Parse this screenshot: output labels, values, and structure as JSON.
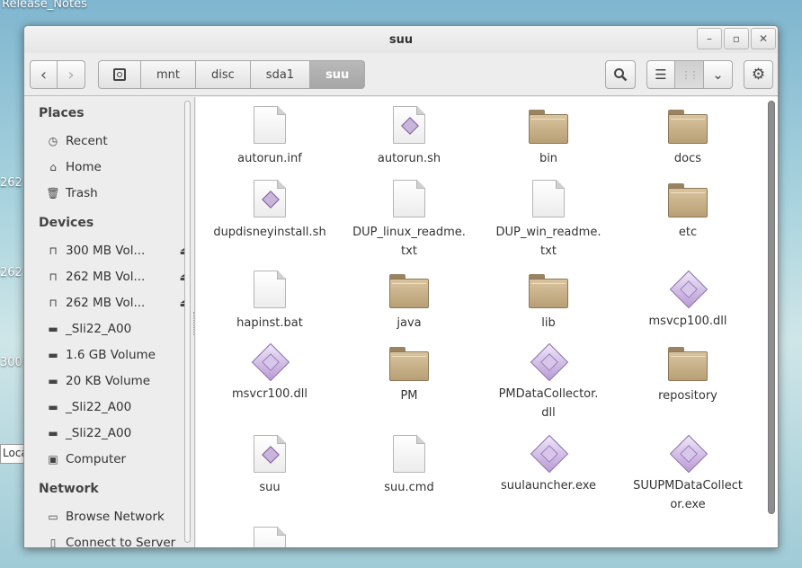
{
  "desktop": {
    "top_label": "Release_Notes",
    "side_numbers": [
      "262",
      "262",
      "300"
    ],
    "side_label": "Loca"
  },
  "window": {
    "title": "suu",
    "wm": {
      "minimize": "–",
      "maximize": "▫",
      "close": "✕"
    }
  },
  "toolbar": {
    "back_glyph": "‹",
    "forward_glyph": "›",
    "breadcrumbs": [
      "mnt",
      "disc",
      "sda1",
      "suu"
    ],
    "search_glyph": "🔍",
    "list_glyph": "☰",
    "grid_glyph": "⋮⋮",
    "dropdown_glyph": "⌄",
    "settings_glyph": "⚙"
  },
  "sidebar": {
    "places_heading": "Places",
    "places": [
      {
        "label": "Recent",
        "icon": "clock-icon",
        "glyph": "◷"
      },
      {
        "label": "Home",
        "icon": "home-icon",
        "glyph": "⌂"
      },
      {
        "label": "Trash",
        "icon": "trash-icon",
        "glyph": "🗑"
      }
    ],
    "devices_heading": "Devices",
    "devices": [
      {
        "label": "300 MB Vol...",
        "icon": "usb-icon",
        "glyph": "⊓",
        "eject": "⏏"
      },
      {
        "label": "262 MB Vol...",
        "icon": "usb-icon",
        "glyph": "⊓",
        "eject": "⏏"
      },
      {
        "label": "262 MB Vol...",
        "icon": "usb-icon",
        "glyph": "⊓",
        "eject": "⏏"
      },
      {
        "label": "_Sli22_A00",
        "icon": "drive-icon",
        "glyph": "▬"
      },
      {
        "label": "1.6 GB Volume",
        "icon": "drive-icon",
        "glyph": "▬"
      },
      {
        "label": "20 KB Volume",
        "icon": "drive-icon",
        "glyph": "▬"
      },
      {
        "label": "_Sli22_A00",
        "icon": "drive-icon",
        "glyph": "▬"
      },
      {
        "label": "_Sli22_A00",
        "icon": "drive-icon",
        "glyph": "▬"
      },
      {
        "label": "Computer",
        "icon": "computer-icon",
        "glyph": "▣"
      }
    ],
    "network_heading": "Network",
    "network": [
      {
        "label": "Browse Network",
        "icon": "network-icon",
        "glyph": "▭"
      },
      {
        "label": "Connect to Server",
        "icon": "server-icon",
        "glyph": "▯"
      }
    ]
  },
  "files": [
    {
      "name": "autorun.inf",
      "type": "doc"
    },
    {
      "name": "autorun.sh",
      "type": "script"
    },
    {
      "name": "bin",
      "type": "folder"
    },
    {
      "name": "docs",
      "type": "folder"
    },
    {
      "name": "dupdisneyinstall.sh",
      "type": "script"
    },
    {
      "name": "DUP_linux_readme.\ntxt",
      "type": "doc"
    },
    {
      "name": "DUP_win_readme.\ntxt",
      "type": "doc"
    },
    {
      "name": "etc",
      "type": "folder"
    },
    {
      "name": "hapinst.bat",
      "type": "doc"
    },
    {
      "name": "java",
      "type": "folder"
    },
    {
      "name": "lib",
      "type": "folder"
    },
    {
      "name": "msvcp100.dll",
      "type": "exec"
    },
    {
      "name": "msvcr100.dll",
      "type": "exec"
    },
    {
      "name": "PM",
      "type": "folder"
    },
    {
      "name": "PMDataCollector.\ndll",
      "type": "exec"
    },
    {
      "name": "repository",
      "type": "folder"
    },
    {
      "name": "suu",
      "type": "script"
    },
    {
      "name": "suu.cmd",
      "type": "doc"
    },
    {
      "name": "suulauncher.exe",
      "type": "exec"
    },
    {
      "name": "SUUPMDataCollect\nor.exe",
      "type": "exec"
    },
    {
      "name": "",
      "type": "doc"
    }
  ]
}
